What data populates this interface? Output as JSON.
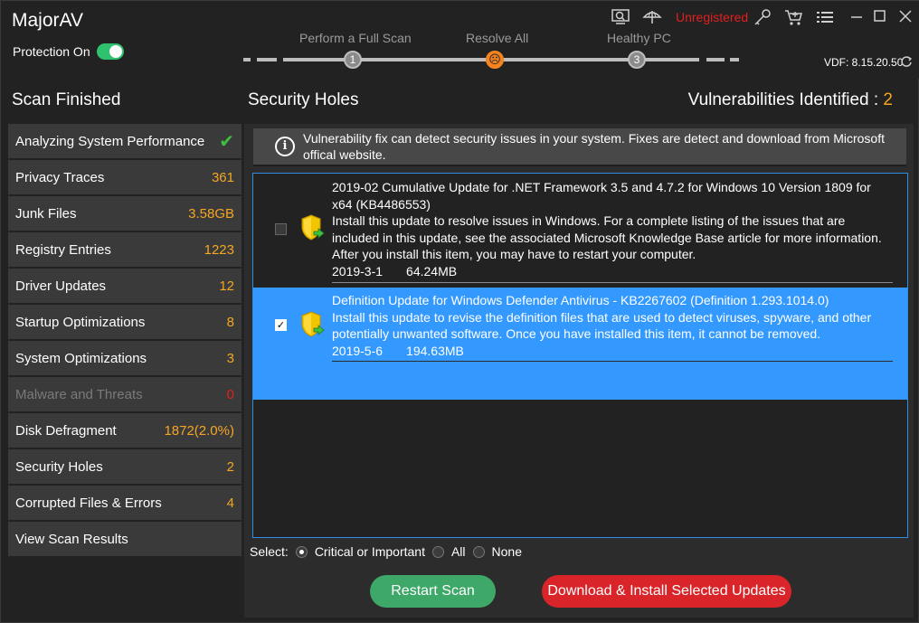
{
  "header": {
    "app_title": "MajorAV",
    "protection_label": "Protection On",
    "steps": [
      "Perform a Full Scan",
      "Resolve All",
      "Healthy PC"
    ],
    "step_numbers": [
      "1",
      "☹",
      "3"
    ],
    "unregistered": "Unregistered",
    "vdf": "VDF: 8.15.20.50",
    "icons": [
      "scan-icon",
      "umbrella-icon",
      "key-icon",
      "cart-icon",
      "menu-icon",
      "minimize-icon",
      "maximize-icon",
      "close-icon"
    ]
  },
  "left": {
    "heading": "Scan Finished",
    "items": [
      {
        "label": "Analyzing System Performance",
        "value": "✔"
      },
      {
        "label": "Privacy Traces",
        "value": "361"
      },
      {
        "label": "Junk Files",
        "value": "3.58GB"
      },
      {
        "label": "Registry Entries",
        "value": "1223"
      },
      {
        "label": "Driver Updates",
        "value": "12"
      },
      {
        "label": "Startup Optimizations",
        "value": "8"
      },
      {
        "label": "System Optimizations",
        "value": "3"
      },
      {
        "label": "Malware and Threats",
        "value": "0"
      },
      {
        "label": "Disk Defragment",
        "value": "1872(2.0%)"
      },
      {
        "label": "Security Holes",
        "value": "2"
      },
      {
        "label": "Corrupted Files & Errors",
        "value": "4"
      },
      {
        "label": "View Scan Results",
        "value": ""
      }
    ]
  },
  "main": {
    "heading": "Security Holes",
    "vuln_label": "Vulnerabilities Identified : ",
    "vuln_count": "2",
    "info_text": "Vulnerability fix can detect security issues in your system. Fixes are detect and download from Microsoft offical website.",
    "updates": [
      {
        "title": "2019-02 Cumulative Update for .NET Framework 3.5 and 4.7.2 for Windows 10 Version 1809 for x64 (KB4486553)",
        "description": "Install this update to resolve issues in Windows. For a complete listing of the issues that are included in this update, see the associated Microsoft Knowledge Base article for more information. After you install this item, you may have to restart your computer.",
        "date": "2019-3-1",
        "size": "64.24MB",
        "checked": false
      },
      {
        "title": "Definition Update for Windows Defender Antivirus - KB2267602 (Definition 1.293.1014.0)",
        "description": "Install this update to revise the definition files that are used to detect viruses, spyware, and other potentially unwanted software. Once you have installed this item, it cannot be removed.",
        "date": "2019-5-6",
        "size": "194.63MB",
        "checked": true
      }
    ],
    "select_label": "Select:",
    "select_options": [
      "Critical or Important",
      "All",
      "None"
    ],
    "selected_option": "Critical or Important",
    "restart_button": "Restart Scan",
    "install_button": "Download & Install Selected Updates"
  },
  "colors": {
    "accent_orange": "#f5a623",
    "toggle_green": "#2ec26e",
    "selected_blue": "#3399ff",
    "unregistered_red": "#e02020",
    "restart_green": "#3ea869",
    "install_red": "#d9252a"
  }
}
